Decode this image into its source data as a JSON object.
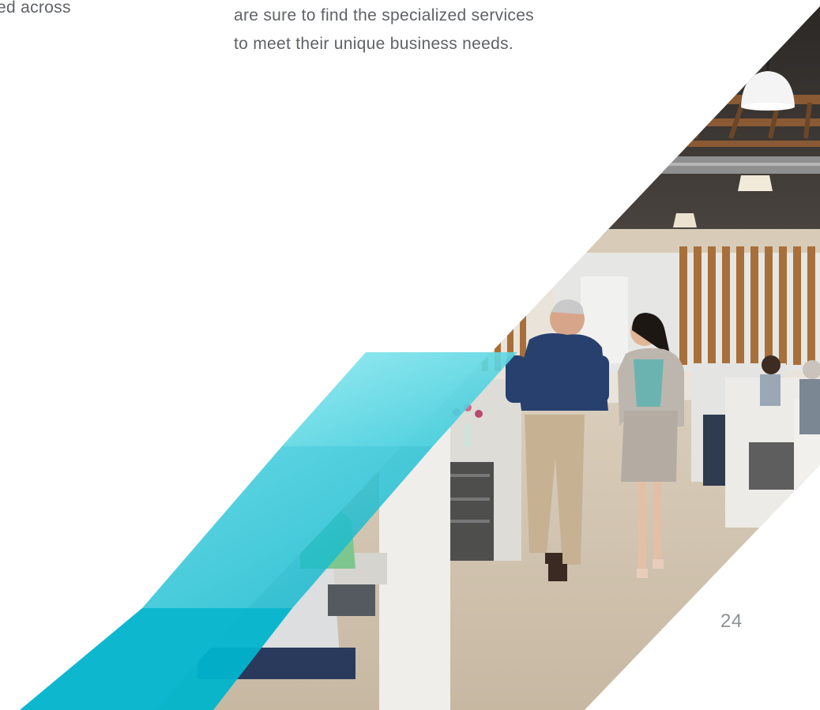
{
  "page": {
    "left_text_fragment": "ed across",
    "body_lines": [
      "are sure to find the specialized services",
      "to meet their unique business needs."
    ],
    "page_number": "24"
  },
  "photo": {
    "subject": "office-photo"
  },
  "colors": {
    "text": "#5f6266",
    "page_number": "#8e9296",
    "accent_teal_light": "#6fdde7",
    "accent_teal_dark": "#00b4cc"
  }
}
